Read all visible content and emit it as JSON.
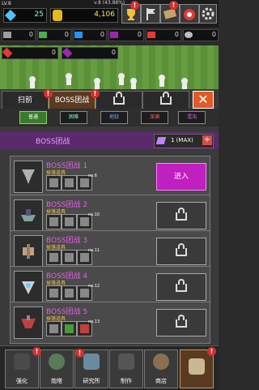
{
  "top": {
    "level": "LV.8",
    "version": "v.8 (43.88%)",
    "gems": "25",
    "coins": "4,106"
  },
  "resources_row1": [
    {
      "icon": "gray-ore-icon",
      "color": "#9e9e9e",
      "value": "0"
    },
    {
      "icon": "green-ore-icon",
      "color": "#4caf50",
      "value": "0"
    },
    {
      "icon": "blue-ore-icon",
      "color": "#2196f3",
      "value": "0"
    },
    {
      "icon": "purple-ore-icon",
      "color": "#9c27b0",
      "value": "0"
    },
    {
      "icon": "red-ore-icon",
      "color": "#e53935",
      "value": "0"
    },
    {
      "icon": "gray-gear-icon",
      "color": "#bdbdbd",
      "value": "0"
    }
  ],
  "resources_row2": [
    {
      "icon": "red-crystal-icon",
      "color": "#e53935",
      "value": "0"
    },
    {
      "icon": "purple-crystal-icon",
      "color": "#9c27b0",
      "value": "0"
    }
  ],
  "tabs": [
    {
      "label": "扫前",
      "active": false
    },
    {
      "label": "BOSS团战",
      "active": true
    },
    {
      "label": "",
      "active": false
    },
    {
      "label": "",
      "active": false
    }
  ],
  "difficulties": [
    "普通",
    "困难",
    "地狱",
    "深渊",
    "混沌"
  ],
  "header": {
    "title": "BOSS团战",
    "tickets": "1 (MAX)"
  },
  "bosses": [
    {
      "name": "BOSS团战 1",
      "sub": "掉落道具",
      "no": "no.6",
      "unlocked": true,
      "btn": "进入"
    },
    {
      "name": "BOSS团战 2",
      "sub": "掉落道具",
      "no": "no.10",
      "unlocked": false,
      "btn": ""
    },
    {
      "name": "BOSS团战 3",
      "sub": "掉落道具",
      "no": "no.11",
      "unlocked": false,
      "btn": ""
    },
    {
      "name": "BOSS团战 4",
      "sub": "掉落道具",
      "no": "no.12",
      "unlocked": false,
      "btn": ""
    },
    {
      "name": "BOSS团战 5",
      "sub": "掉落道具",
      "no": "no.13",
      "unlocked": false,
      "btn": ""
    }
  ],
  "nav": [
    {
      "label": "强化",
      "icon": "upgrade-icon"
    },
    {
      "label": "炮塔",
      "icon": "turret-icon"
    },
    {
      "label": "研究所",
      "icon": "lab-icon"
    },
    {
      "label": "制作",
      "icon": "craft-icon"
    },
    {
      "label": "商店",
      "icon": "shop-icon"
    },
    {
      "label": "",
      "icon": "map-icon"
    }
  ]
}
